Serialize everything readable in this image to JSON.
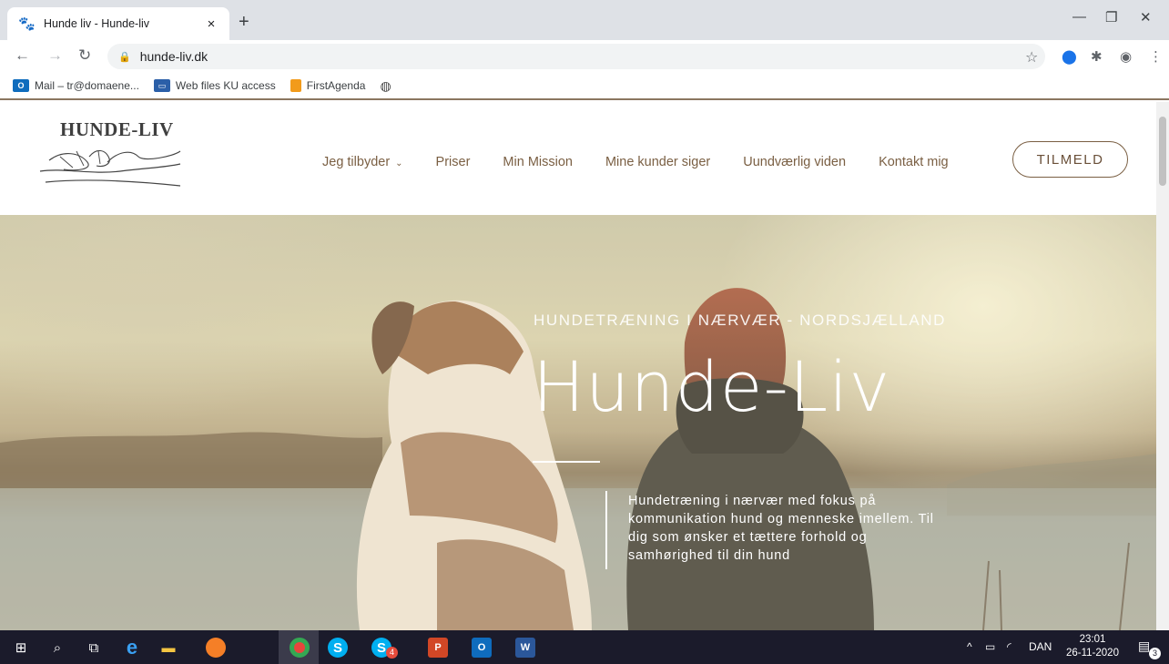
{
  "browser": {
    "tab_title": "Hunde liv - Hunde-liv",
    "tab_close": "×",
    "new_tab": "+",
    "url": "hunde-liv.dk",
    "bookmarks": [
      {
        "label": "Mail – tr@domaene...",
        "icon": "outlook-icon",
        "color": "#0f6cbd"
      },
      {
        "label": "Web files KU access",
        "icon": "ku-icon",
        "color": "#2b5fa8"
      },
      {
        "label": "FirstAgenda",
        "icon": "firstagenda-icon",
        "color": "#f29b1b"
      },
      {
        "label": "",
        "icon": "globe-icon",
        "color": "#555555"
      }
    ]
  },
  "site": {
    "logo_text": "HUNDE-LIV",
    "nav": [
      {
        "label": "Jeg tilbyder",
        "has_dropdown": true
      },
      {
        "label": "Priser"
      },
      {
        "label": "Min Mission"
      },
      {
        "label": "Mine kunder siger"
      },
      {
        "label": "Uundværlig viden"
      },
      {
        "label": "Kontakt mig"
      }
    ],
    "signup_label": "TILMELD",
    "accent_color": "#7a5f43"
  },
  "hero": {
    "subtitle": "HUNDETRÆNING I NÆRVÆR - NORDSJÆLLAND",
    "title": "Hunde-Liv",
    "description": "Hundetræning i nærvær med fokus på kommunikation hund og menneske imellem. Til dig som ønsker et tættere forhold og samhørighed til din hund"
  },
  "taskbar": {
    "language": "DAN",
    "time": "23:01",
    "date": "26-11-2020",
    "notification_count": "3",
    "skype_badge": "4"
  }
}
